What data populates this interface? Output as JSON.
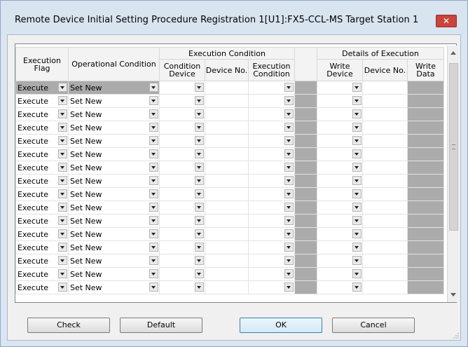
{
  "window": {
    "title": "Remote Device Initial Setting Procedure Registration  1[U1]:FX5-CCL-MS Target Station 1",
    "close_label": "✕"
  },
  "table": {
    "headers": {
      "execution_flag": "Execution Flag",
      "operational_condition": "Operational Condition",
      "execution_condition_group": "Execution Condition",
      "condition_device": "Condition Device",
      "device_no": "Device No.",
      "execution_condition": "Execution Condition",
      "details_group": "Details of Execution",
      "write_device": "Write Device",
      "device_no_2": "Device No.",
      "write_data": "Write Data"
    },
    "rows": [
      {
        "execution_flag": "Execute",
        "operational_condition": "Set New"
      },
      {
        "execution_flag": "Execute",
        "operational_condition": "Set New"
      },
      {
        "execution_flag": "Execute",
        "operational_condition": "Set New"
      },
      {
        "execution_flag": "Execute",
        "operational_condition": "Set New"
      },
      {
        "execution_flag": "Execute",
        "operational_condition": "Set New"
      },
      {
        "execution_flag": "Execute",
        "operational_condition": "Set New"
      },
      {
        "execution_flag": "Execute",
        "operational_condition": "Set New"
      },
      {
        "execution_flag": "Execute",
        "operational_condition": "Set New"
      },
      {
        "execution_flag": "Execute",
        "operational_condition": "Set New"
      },
      {
        "execution_flag": "Execute",
        "operational_condition": "Set New"
      },
      {
        "execution_flag": "Execute",
        "operational_condition": "Set New"
      },
      {
        "execution_flag": "Execute",
        "operational_condition": "Set New"
      },
      {
        "execution_flag": "Execute",
        "operational_condition": "Set New"
      },
      {
        "execution_flag": "Execute",
        "operational_condition": "Set New"
      },
      {
        "execution_flag": "Execute",
        "operational_condition": "Set New"
      },
      {
        "execution_flag": "Execute",
        "operational_condition": "Set New"
      }
    ]
  },
  "buttons": {
    "check": "Check",
    "default": "Default",
    "ok": "OK",
    "cancel": "Cancel"
  },
  "colors": {
    "disabled_cell": "#ababab",
    "title_bar": "#d9e4f1",
    "close_button": "#c8453c"
  }
}
